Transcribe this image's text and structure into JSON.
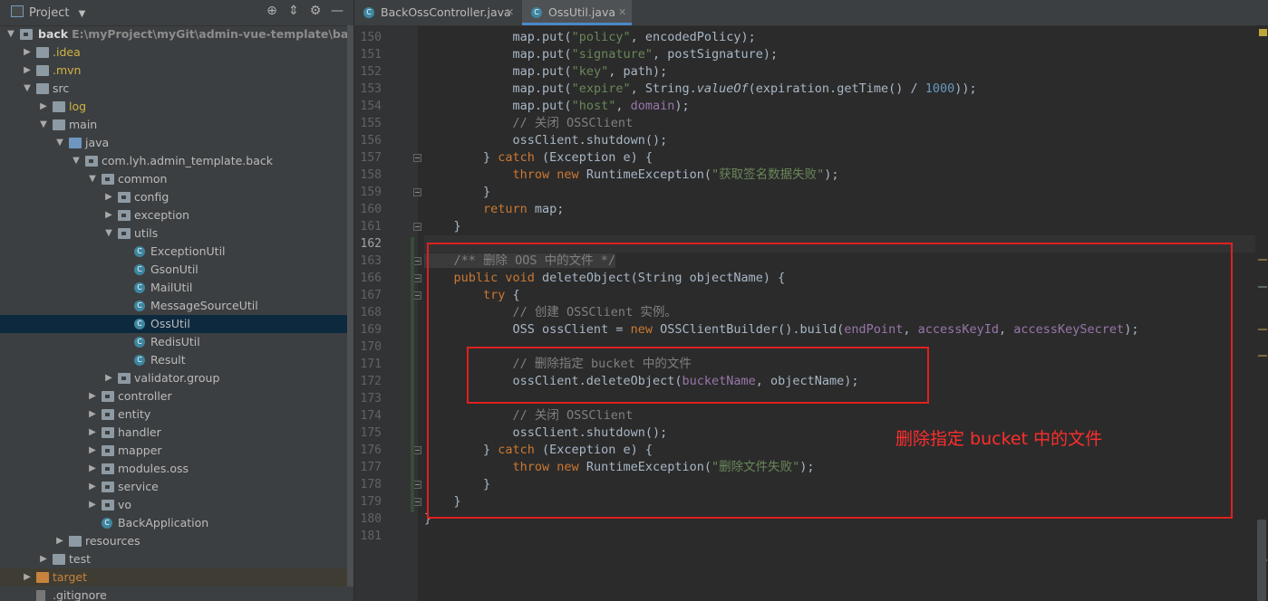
{
  "sidebar": {
    "title": "Project",
    "root_label": "back",
    "root_path": "E:\\myProject\\myGit\\admin-vue-template\\back",
    "items": [
      {
        "label": ".idea",
        "depth": 1,
        "type": "folder",
        "color": "yellow",
        "expanded": false
      },
      {
        "label": ".mvn",
        "depth": 1,
        "type": "folder",
        "color": "yellow",
        "expanded": false
      },
      {
        "label": "src",
        "depth": 1,
        "type": "folder",
        "expanded": true
      },
      {
        "label": "log",
        "depth": 2,
        "type": "folder",
        "color": "yellow",
        "expanded": false
      },
      {
        "label": "main",
        "depth": 2,
        "type": "folder",
        "expanded": true
      },
      {
        "label": "java",
        "depth": 3,
        "type": "folder-blue",
        "expanded": true
      },
      {
        "label": "com.lyh.admin_template.back",
        "depth": 4,
        "type": "package",
        "expanded": true
      },
      {
        "label": "common",
        "depth": 5,
        "type": "package",
        "expanded": true
      },
      {
        "label": "config",
        "depth": 6,
        "type": "package",
        "expanded": false
      },
      {
        "label": "exception",
        "depth": 6,
        "type": "package",
        "expanded": false
      },
      {
        "label": "utils",
        "depth": 6,
        "type": "package",
        "expanded": true
      },
      {
        "label": "ExceptionUtil",
        "depth": 7,
        "type": "class"
      },
      {
        "label": "GsonUtil",
        "depth": 7,
        "type": "class"
      },
      {
        "label": "MailUtil",
        "depth": 7,
        "type": "class"
      },
      {
        "label": "MessageSourceUtil",
        "depth": 7,
        "type": "class"
      },
      {
        "label": "OssUtil",
        "depth": 7,
        "type": "class",
        "selected": true
      },
      {
        "label": "RedisUtil",
        "depth": 7,
        "type": "class"
      },
      {
        "label": "Result",
        "depth": 7,
        "type": "class"
      },
      {
        "label": "validator.group",
        "depth": 6,
        "type": "package",
        "expanded": false
      },
      {
        "label": "controller",
        "depth": 5,
        "type": "package",
        "expanded": false
      },
      {
        "label": "entity",
        "depth": 5,
        "type": "package",
        "expanded": false
      },
      {
        "label": "handler",
        "depth": 5,
        "type": "package",
        "expanded": false
      },
      {
        "label": "mapper",
        "depth": 5,
        "type": "package",
        "expanded": false
      },
      {
        "label": "modules.oss",
        "depth": 5,
        "type": "package",
        "expanded": false
      },
      {
        "label": "service",
        "depth": 5,
        "type": "package",
        "expanded": false
      },
      {
        "label": "vo",
        "depth": 5,
        "type": "package",
        "expanded": false
      },
      {
        "label": "BackApplication",
        "depth": 5,
        "type": "class-app"
      },
      {
        "label": "resources",
        "depth": 3,
        "type": "folder",
        "expanded": false
      },
      {
        "label": "test",
        "depth": 2,
        "type": "folder",
        "expanded": false
      },
      {
        "label": "target",
        "depth": 1,
        "type": "folder",
        "color": "orange",
        "expanded": false,
        "excluded": true
      },
      {
        "label": ".gitignore",
        "depth": 1,
        "type": "file"
      }
    ]
  },
  "tabs": [
    {
      "label": "BackOssController.java",
      "active": false
    },
    {
      "label": "OssUtil.java",
      "active": true
    }
  ],
  "editor": {
    "lines": [
      {
        "n": "150",
        "fold": false,
        "tokens": [
          [
            "",
            "            map.put("
          ],
          [
            "str",
            "\"policy\""
          ],
          [
            "",
            ", encodedPolicy);"
          ]
        ]
      },
      {
        "n": "151",
        "fold": false,
        "tokens": [
          [
            "",
            "            map.put("
          ],
          [
            "str",
            "\"signature\""
          ],
          [
            "",
            ", postSignature);"
          ]
        ]
      },
      {
        "n": "152",
        "fold": false,
        "tokens": [
          [
            "",
            "            map.put("
          ],
          [
            "str",
            "\"key\""
          ],
          [
            "",
            ", path);"
          ]
        ]
      },
      {
        "n": "153",
        "fold": false,
        "tokens": [
          [
            "",
            "            map.put("
          ],
          [
            "str",
            "\"expire\""
          ],
          [
            "",
            ", String."
          ],
          [
            "ital",
            "valueOf"
          ],
          [
            "",
            "(expiration.getTime() / "
          ],
          [
            "num",
            "1000"
          ],
          [
            "",
            "));"
          ]
        ]
      },
      {
        "n": "154",
        "fold": false,
        "tokens": [
          [
            "",
            "            map.put("
          ],
          [
            "str",
            "\"host\""
          ],
          [
            "",
            ", "
          ],
          [
            "fld",
            "domain"
          ],
          [
            "",
            ");"
          ]
        ]
      },
      {
        "n": "155",
        "fold": false,
        "tokens": [
          [
            "com",
            "            // 关闭 OSSClient"
          ]
        ]
      },
      {
        "n": "156",
        "fold": false,
        "tokens": [
          [
            "",
            "            ossClient.shutdown();"
          ]
        ]
      },
      {
        "n": "157",
        "fold": true,
        "tokens": [
          [
            "",
            "        } "
          ],
          [
            "kw",
            "catch"
          ],
          [
            "",
            " (Exception e) {"
          ]
        ]
      },
      {
        "n": "158",
        "fold": false,
        "tokens": [
          [
            "kw",
            "            throw new "
          ],
          [
            "",
            "RuntimeException("
          ],
          [
            "str",
            "\"获取签名数据失败\""
          ],
          [
            "",
            ");"
          ]
        ]
      },
      {
        "n": "159",
        "fold": true,
        "tokens": [
          [
            "",
            "        }"
          ]
        ]
      },
      {
        "n": "160",
        "fold": false,
        "tokens": [
          [
            "kw",
            "        return "
          ],
          [
            "",
            "map;"
          ]
        ]
      },
      {
        "n": "161",
        "fold": true,
        "tokens": [
          [
            "",
            "    }"
          ]
        ]
      },
      {
        "n": "162",
        "fold": false,
        "current": true,
        "tokens": [
          [
            "",
            ""
          ]
        ]
      },
      {
        "n": "163",
        "fold": true,
        "tokens": [
          [
            "com hlbg",
            "    /** 删除 OOS 中的文件 */"
          ]
        ]
      },
      {
        "n": "166",
        "fold": true,
        "tokens": [
          [
            "kw",
            "    public void "
          ],
          [
            "",
            "deleteObject(String objectName) {"
          ]
        ]
      },
      {
        "n": "167",
        "fold": true,
        "tokens": [
          [
            "kw",
            "        try "
          ],
          [
            "",
            "{"
          ]
        ]
      },
      {
        "n": "168",
        "fold": false,
        "tokens": [
          [
            "com",
            "            // 创建 OSSClient 实例。"
          ]
        ]
      },
      {
        "n": "169",
        "fold": false,
        "tokens": [
          [
            "",
            "            OSS ossClient = "
          ],
          [
            "kw",
            "new "
          ],
          [
            "",
            "OSSClientBuilder().build("
          ],
          [
            "fld",
            "endPoint"
          ],
          [
            "",
            ", "
          ],
          [
            "fld",
            "accessKeyId"
          ],
          [
            "",
            ", "
          ],
          [
            "fld",
            "accessKeySecret"
          ],
          [
            "",
            ");"
          ]
        ]
      },
      {
        "n": "170",
        "fold": false,
        "tokens": [
          [
            "",
            ""
          ]
        ]
      },
      {
        "n": "171",
        "fold": false,
        "tokens": [
          [
            "com",
            "            // 删除指定 bucket 中的文件"
          ]
        ]
      },
      {
        "n": "172",
        "fold": false,
        "tokens": [
          [
            "",
            "            ossClient.deleteObject("
          ],
          [
            "fld",
            "bucketName"
          ],
          [
            "",
            ", objectName);"
          ]
        ]
      },
      {
        "n": "173",
        "fold": false,
        "tokens": [
          [
            "",
            ""
          ]
        ]
      },
      {
        "n": "174",
        "fold": false,
        "tokens": [
          [
            "com",
            "            // 关闭 OSSClient"
          ]
        ]
      },
      {
        "n": "175",
        "fold": false,
        "tokens": [
          [
            "",
            "            ossClient.shutdown();"
          ]
        ]
      },
      {
        "n": "176",
        "fold": true,
        "tokens": [
          [
            "",
            "        } "
          ],
          [
            "kw",
            "catch"
          ],
          [
            "",
            " (Exception e) {"
          ]
        ]
      },
      {
        "n": "177",
        "fold": false,
        "tokens": [
          [
            "kw",
            "            throw new "
          ],
          [
            "",
            "RuntimeException("
          ],
          [
            "str",
            "\"删除文件失败\""
          ],
          [
            "",
            ");"
          ]
        ]
      },
      {
        "n": "178",
        "fold": true,
        "tokens": [
          [
            "",
            "        }"
          ]
        ]
      },
      {
        "n": "179",
        "fold": true,
        "tokens": [
          [
            "",
            "    }"
          ]
        ]
      },
      {
        "n": "180",
        "fold": false,
        "tokens": [
          [
            "",
            "}"
          ]
        ]
      },
      {
        "n": "181",
        "fold": false,
        "tokens": [
          [
            "",
            ""
          ]
        ]
      }
    ],
    "annotation": "删除指定 bucket 中的文件"
  },
  "colors": {
    "accent": "#4a88c7",
    "highlight_box": "#e02020",
    "selection": "#0d293e"
  }
}
